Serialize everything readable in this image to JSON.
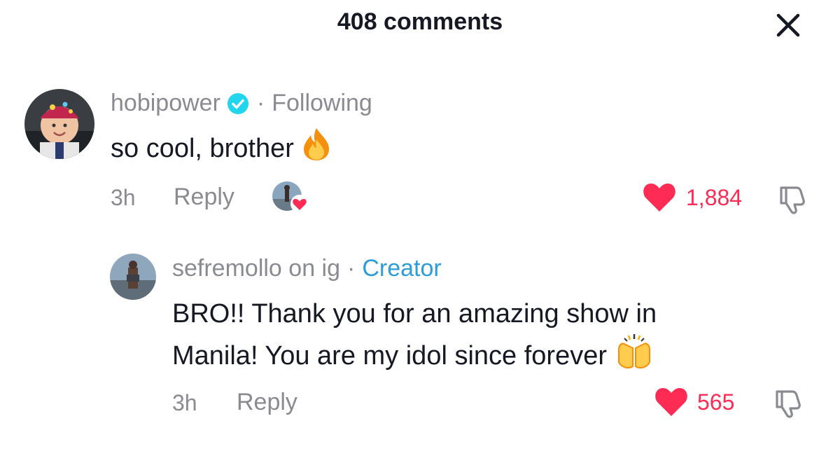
{
  "header": {
    "title": "408 comments",
    "close_icon": "close-icon"
  },
  "comments": [
    {
      "username": "hobipower",
      "verified": true,
      "relation": "Following",
      "text": "so cool, brother",
      "emoji": "fire-emoji",
      "time": "3h",
      "reply_label": "Reply",
      "creator_liked": true,
      "likes": "1,884"
    },
    {
      "username": "sefremollo on ig",
      "verified": false,
      "relation": "Creator",
      "text_line1": "BRO!! Thank you for an amazing show in",
      "text_line2": "Manila! You are my idol since forever",
      "emoji": "raising-hands-emoji",
      "time": "3h",
      "reply_label": "Reply",
      "likes": "565"
    }
  ],
  "colors": {
    "like": "#fe2c55",
    "meta": "#8a8b91",
    "creator": "#2d9cd9",
    "verified": "#20d5ec"
  }
}
